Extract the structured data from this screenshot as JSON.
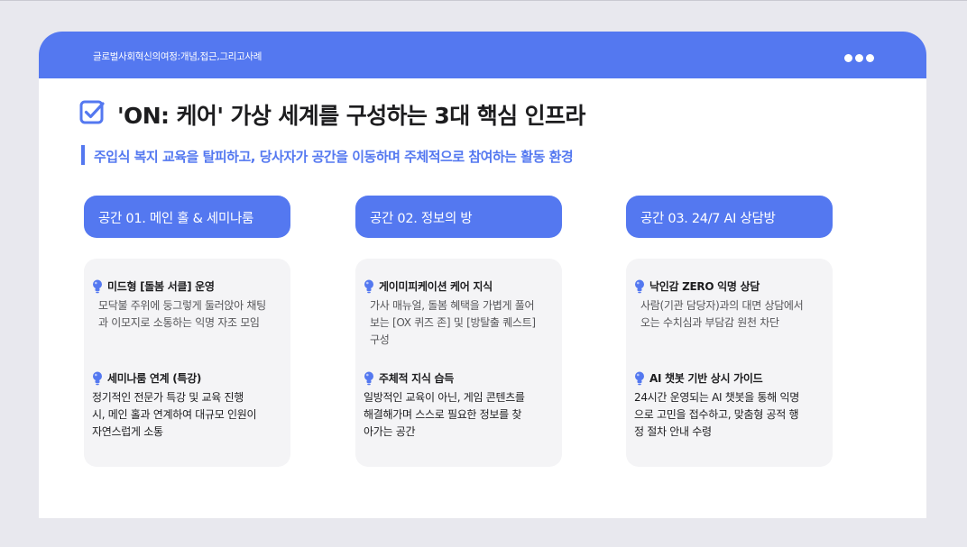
{
  "header": {
    "breadcrumb": "글로벌사회혁신의여정:개념,접근,그리고사례",
    "more_icon": "more-horizontal-icon"
  },
  "heading": {
    "icon": "checkbox-icon",
    "title": "'ON: 케어' 가상 세계를 구성하는 3대 핵심 인프라",
    "subtitle": "주입식 복지 교육을 탈피하고, 당사자가 공간을 이동하며 주체적으로 참여하는 활동 환경"
  },
  "colors": {
    "accent": "#5478f0",
    "card_bg": "#f4f4f6",
    "page_bg": "#e8e8ee",
    "text_dark": "#1d1d1f"
  },
  "spaces": [
    {
      "label": "공간 01. 메인 홀 & 세미나룸",
      "features": [
        {
          "icon": "lightbulb-icon",
          "title": "미드형 [돌봄 서클] 운영",
          "desc_lines": [
            "모닥불 주위에 둥그렇게 둘러앉아 채팅",
            "과 이모지로 소통하는 익명 자조 모임"
          ]
        },
        {
          "icon": "lightbulb-icon",
          "title": "세미나룸 연계 (특강)",
          "desc_lines": [
            "정기적인 전문가 특강 및 교육 진행",
            "시, 메인 홀과 연계하여 대규모 인원이",
            "자연스럽게 소통"
          ]
        }
      ]
    },
    {
      "label": "공간 02. 정보의 방",
      "features": [
        {
          "icon": "lightbulb-icon",
          "title": "게이미피케이션 케어 지식",
          "desc_lines": [
            "가사 매뉴얼, 돌봄 혜택을 가볍게 풀어",
            "보는 [OX 퀴즈 존] 및 [방탈출 퀘스트]",
            "구성"
          ]
        },
        {
          "icon": "lightbulb-icon",
          "title": "주체적 지식 습득",
          "desc_lines": [
            "일방적인 교육이 아닌, 게임 콘텐츠를",
            "해결해가며 스스로 필요한 정보를 찾",
            "아가는 공간"
          ]
        }
      ]
    },
    {
      "label": "공간 03. 24/7 AI 상담방",
      "features": [
        {
          "icon": "lightbulb-icon",
          "title": "낙인감 ZERO 익명 상담",
          "desc_lines": [
            "사람(기관 담당자)과의 대면 상담에서",
            "오는 수치심과 부담감 원천 차단"
          ]
        },
        {
          "icon": "lightbulb-icon",
          "title": "AI 챗봇 기반 상시 가이드",
          "desc_lines": [
            "24시간 운영되는 AI 챗봇을 통해 익명",
            "으로 고민을 접수하고, 맞춤형 공적 행",
            "정 절차 안내 수령"
          ]
        }
      ]
    }
  ]
}
